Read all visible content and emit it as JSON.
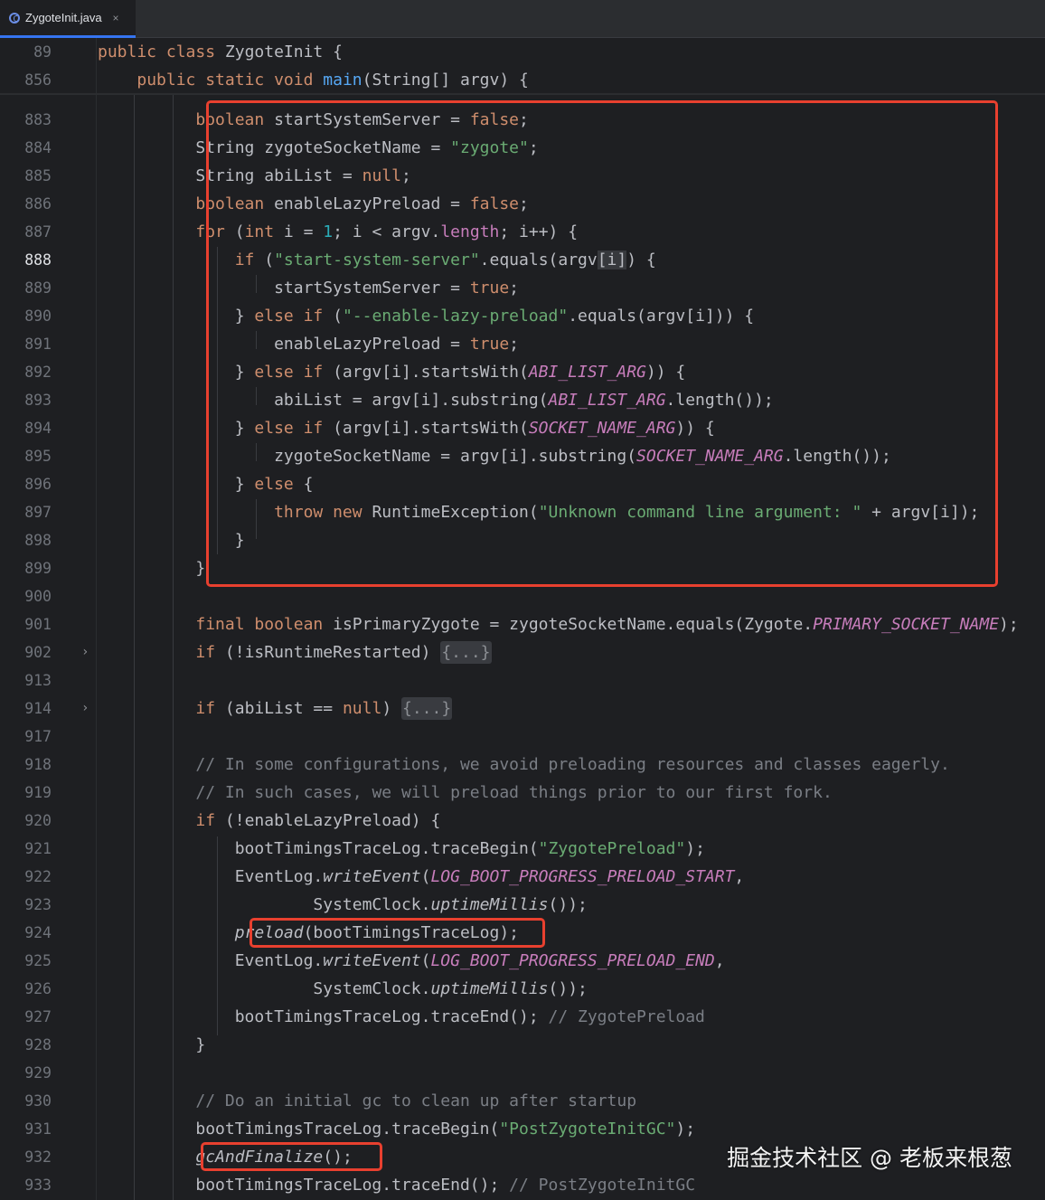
{
  "tab": {
    "filename": "ZygoteInit.java",
    "close": "×",
    "icon": "java-class-icon"
  },
  "lines": [
    {
      "n": "89",
      "tokens": [
        [
          "kw",
          "public "
        ],
        [
          "kw",
          "class "
        ],
        [
          "",
          "ZygoteInit {"
        ]
      ]
    },
    {
      "n": "856",
      "tokens": [
        [
          "",
          "    "
        ],
        [
          "kw",
          "public "
        ],
        [
          "kw",
          "static "
        ],
        [
          "kw",
          "void "
        ],
        [
          "mth",
          "main"
        ],
        [
          "",
          "(String[] argv) {"
        ]
      ]
    },
    {
      "n": "883",
      "tokens": [
        [
          "",
          "          "
        ],
        [
          "kw",
          "boolean"
        ],
        [
          "",
          " startSystemServer = "
        ],
        [
          "kw",
          "false"
        ],
        [
          "",
          ";"
        ]
      ]
    },
    {
      "n": "884",
      "tokens": [
        [
          "",
          "          String zygoteSocketName = "
        ],
        [
          "str",
          "\"zygote\""
        ],
        [
          "",
          ";"
        ]
      ]
    },
    {
      "n": "885",
      "tokens": [
        [
          "",
          "          String abiList = "
        ],
        [
          "kw",
          "null"
        ],
        [
          "",
          ";"
        ]
      ]
    },
    {
      "n": "886",
      "tokens": [
        [
          "",
          "          "
        ],
        [
          "kw",
          "boolean"
        ],
        [
          "",
          " enableLazyPreload = "
        ],
        [
          "kw",
          "false"
        ],
        [
          "",
          ";"
        ]
      ]
    },
    {
      "n": "887",
      "tokens": [
        [
          "",
          "          "
        ],
        [
          "kw",
          "for"
        ],
        [
          "",
          " ("
        ],
        [
          "kw",
          "int"
        ],
        [
          "",
          " i = "
        ],
        [
          "num",
          "1"
        ],
        [
          "",
          "; i < argv."
        ],
        [
          "fld-n",
          "length"
        ],
        [
          "",
          "; i++) {"
        ]
      ]
    },
    {
      "n": "888",
      "tokens": [
        [
          "",
          "              "
        ],
        [
          "kw",
          "if"
        ],
        [
          "",
          " ("
        ],
        [
          "str",
          "\"start-system-server\""
        ],
        [
          "",
          ".equals(argv"
        ],
        [
          "hl",
          "[i]"
        ],
        [
          "",
          ") {"
        ]
      ]
    },
    {
      "n": "889",
      "tokens": [
        [
          "",
          "                  startSystemServer = "
        ],
        [
          "kw",
          "true"
        ],
        [
          "",
          ";"
        ]
      ]
    },
    {
      "n": "890",
      "tokens": [
        [
          "",
          "              } "
        ],
        [
          "kw",
          "else if"
        ],
        [
          "",
          " ("
        ],
        [
          "str",
          "\"--enable-lazy-preload\""
        ],
        [
          "",
          ".equals(argv[i])) {"
        ]
      ]
    },
    {
      "n": "891",
      "tokens": [
        [
          "",
          "                  enableLazyPreload = "
        ],
        [
          "kw",
          "true"
        ],
        [
          "",
          ";"
        ]
      ]
    },
    {
      "n": "892",
      "tokens": [
        [
          "",
          "              } "
        ],
        [
          "kw",
          "else if"
        ],
        [
          "",
          " (argv[i].startsWith("
        ],
        [
          "fld",
          "ABI_LIST_ARG"
        ],
        [
          "",
          ")) {"
        ]
      ]
    },
    {
      "n": "893",
      "tokens": [
        [
          "",
          "                  abiList = argv[i].substring("
        ],
        [
          "fld",
          "ABI_LIST_ARG"
        ],
        [
          "",
          ".length());"
        ]
      ]
    },
    {
      "n": "894",
      "tokens": [
        [
          "",
          "              } "
        ],
        [
          "kw",
          "else if"
        ],
        [
          "",
          " (argv[i].startsWith("
        ],
        [
          "fld",
          "SOCKET_NAME_ARG"
        ],
        [
          "",
          ")) {"
        ]
      ]
    },
    {
      "n": "895",
      "tokens": [
        [
          "",
          "                  zygoteSocketName = argv[i].substring("
        ],
        [
          "fld",
          "SOCKET_NAME_ARG"
        ],
        [
          "",
          ".length());"
        ]
      ]
    },
    {
      "n": "896",
      "tokens": [
        [
          "",
          "              } "
        ],
        [
          "kw",
          "else"
        ],
        [
          "",
          " {"
        ]
      ]
    },
    {
      "n": "897",
      "tokens": [
        [
          "",
          "                  "
        ],
        [
          "kw",
          "throw new"
        ],
        [
          "",
          " RuntimeException("
        ],
        [
          "str",
          "\"Unknown command line argument: \""
        ],
        [
          "",
          " + argv[i]);"
        ]
      ]
    },
    {
      "n": "898",
      "tokens": [
        [
          "",
          "              }"
        ]
      ]
    },
    {
      "n": "899",
      "tokens": [
        [
          "",
          "          }"
        ]
      ]
    },
    {
      "n": "900",
      "tokens": []
    },
    {
      "n": "901",
      "tokens": [
        [
          "",
          "          "
        ],
        [
          "kw",
          "final boolean"
        ],
        [
          "",
          " isPrimaryZygote = zygoteSocketName.equals(Zygote."
        ],
        [
          "fld",
          "PRIMARY_SOCKET_NAME"
        ],
        [
          "",
          ");"
        ]
      ]
    },
    {
      "n": "902",
      "fold": true,
      "tokens": [
        [
          "",
          "          "
        ],
        [
          "kw",
          "if"
        ],
        [
          "",
          " (!isRuntimeRestarted) "
        ],
        [
          "fd",
          "{...}"
        ]
      ]
    },
    {
      "n": "913",
      "tokens": []
    },
    {
      "n": "914",
      "fold": true,
      "tokens": [
        [
          "",
          "          "
        ],
        [
          "kw",
          "if"
        ],
        [
          "",
          " (abiList == "
        ],
        [
          "kw",
          "null"
        ],
        [
          "",
          ") "
        ],
        [
          "fd",
          "{...}"
        ]
      ]
    },
    {
      "n": "917",
      "tokens": []
    },
    {
      "n": "918",
      "tokens": [
        [
          "",
          "          "
        ],
        [
          "cmt",
          "// In some configurations, we avoid preloading resources and classes eagerly."
        ]
      ]
    },
    {
      "n": "919",
      "tokens": [
        [
          "",
          "          "
        ],
        [
          "cmt",
          "// In such cases, we will preload things prior to our first fork."
        ]
      ]
    },
    {
      "n": "920",
      "tokens": [
        [
          "",
          "          "
        ],
        [
          "kw",
          "if"
        ],
        [
          "",
          " (!enableLazyPreload) {"
        ]
      ]
    },
    {
      "n": "921",
      "tokens": [
        [
          "",
          "              bootTimingsTraceLog.traceBegin("
        ],
        [
          "str",
          "\"ZygotePreload\""
        ],
        [
          "",
          ");"
        ]
      ]
    },
    {
      "n": "922",
      "tokens": [
        [
          "",
          "              EventLog."
        ],
        [
          "sfn",
          "writeEvent"
        ],
        [
          "",
          "("
        ],
        [
          "fld",
          "LOG_BOOT_PROGRESS_PRELOAD_START"
        ],
        [
          "",
          ","
        ]
      ]
    },
    {
      "n": "923",
      "tokens": [
        [
          "",
          "                      SystemClock."
        ],
        [
          "sfn",
          "uptimeMillis"
        ],
        [
          "",
          "());"
        ]
      ]
    },
    {
      "n": "924",
      "tokens": [
        [
          "",
          "              "
        ],
        [
          "sfn",
          "preload"
        ],
        [
          "",
          "(bootTimingsTraceLog);"
        ]
      ]
    },
    {
      "n": "925",
      "tokens": [
        [
          "",
          "              EventLog."
        ],
        [
          "sfn",
          "writeEvent"
        ],
        [
          "",
          "("
        ],
        [
          "fld",
          "LOG_BOOT_PROGRESS_PRELOAD_END"
        ],
        [
          "",
          ","
        ]
      ]
    },
    {
      "n": "926",
      "tokens": [
        [
          "",
          "                      SystemClock."
        ],
        [
          "sfn",
          "uptimeMillis"
        ],
        [
          "",
          "());"
        ]
      ]
    },
    {
      "n": "927",
      "tokens": [
        [
          "",
          "              bootTimingsTraceLog.traceEnd(); "
        ],
        [
          "cmt",
          "// ZygotePreload"
        ]
      ]
    },
    {
      "n": "928",
      "tokens": [
        [
          "",
          "          }"
        ]
      ]
    },
    {
      "n": "929",
      "tokens": []
    },
    {
      "n": "930",
      "tokens": [
        [
          "",
          "          "
        ],
        [
          "cmt",
          "// Do an initial gc to clean up after startup"
        ]
      ]
    },
    {
      "n": "931",
      "tokens": [
        [
          "",
          "          bootTimingsTraceLog.traceBegin("
        ],
        [
          "str",
          "\"PostZygoteInitGC\""
        ],
        [
          "",
          ");"
        ]
      ]
    },
    {
      "n": "932",
      "tokens": [
        [
          "",
          "          "
        ],
        [
          "sfn",
          "gcAndFinalize"
        ],
        [
          "",
          "();"
        ]
      ]
    },
    {
      "n": "933",
      "tokens": [
        [
          "",
          "          bootTimingsTraceLog.traceEnd(); "
        ],
        [
          "cmt",
          "// PostZygoteInitGC"
        ]
      ]
    }
  ],
  "current_line": "888",
  "watermark": "掘金技术社区 @ 老板来根葱",
  "colors": {
    "background": "#1e1f22",
    "keyword": "#cf8e6d",
    "string": "#6aab73",
    "number": "#2aacb8",
    "constant": "#c77dbb",
    "method": "#56a8f5",
    "comment": "#7a7e85",
    "highlight_box": "#e8402f"
  }
}
